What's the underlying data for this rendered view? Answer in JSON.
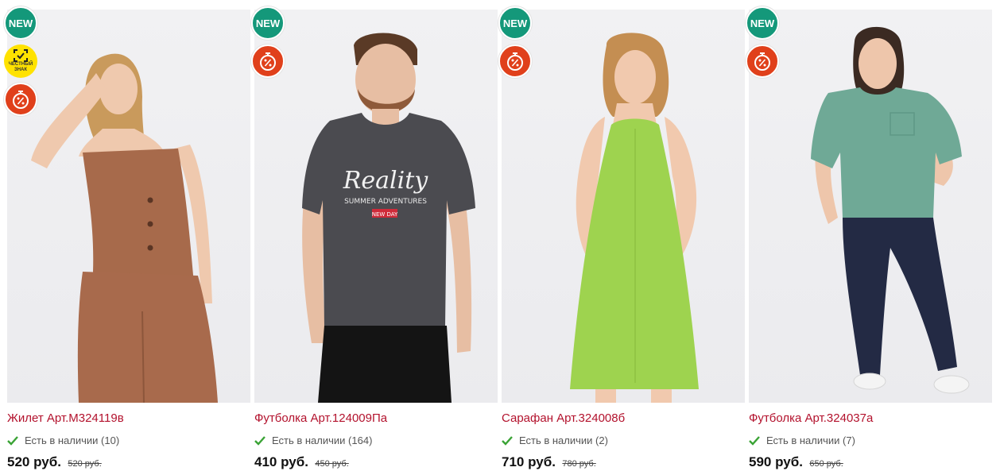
{
  "colors": {
    "accent": "#b3122d",
    "new_badge": "#14987a",
    "sale_badge": "#e0401b",
    "mark_badge": "#ffe200",
    "check": "#3aa335"
  },
  "products": [
    {
      "badges": [
        "NEW",
        "mark",
        "sale"
      ],
      "badge_new_label": "NEW",
      "mark_label": "ЧЕСТНЫЙ ЗНАК",
      "title": "Жилет Арт.М324119в",
      "stock": "Есть в наличии (10)",
      "price": "520 руб.",
      "old_price": "520 руб."
    },
    {
      "badges": [
        "NEW",
        "sale"
      ],
      "badge_new_label": "NEW",
      "shirt_print_main": "Reality",
      "shirt_print_sub": "SUMMER ADVENTURES",
      "shirt_print_tag": "NEW DAY",
      "title": "Футболка Арт.124009Па",
      "stock": "Есть в наличии (164)",
      "price": "410 руб.",
      "old_price": "450 руб."
    },
    {
      "badges": [
        "NEW",
        "sale"
      ],
      "badge_new_label": "NEW",
      "title": "Сарафан Арт.324008б",
      "stock": "Есть в наличии (2)",
      "price": "710 руб.",
      "old_price": "780 руб."
    },
    {
      "badges": [
        "NEW",
        "sale"
      ],
      "badge_new_label": "NEW",
      "title": "Футболка Арт.324037а",
      "stock": "Есть в наличии (7)",
      "price": "590 руб.",
      "old_price": "650 руб."
    }
  ]
}
